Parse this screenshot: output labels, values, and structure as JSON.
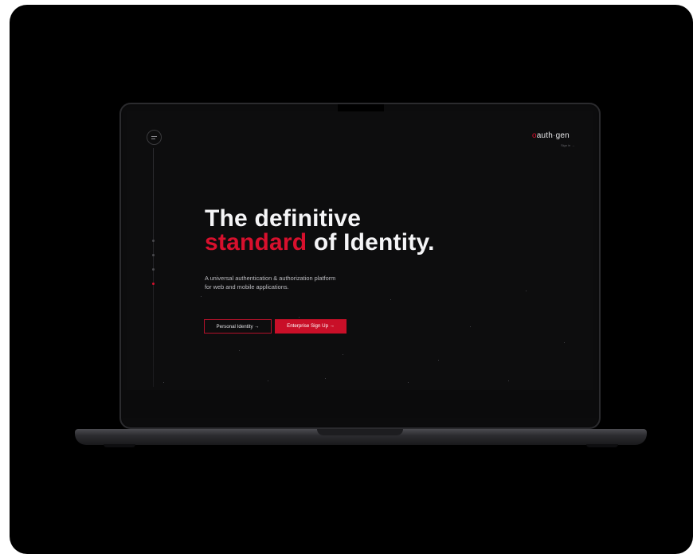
{
  "site": {
    "brand": {
      "prefix": "o",
      "auth": "auth",
      "dot": "·",
      "suffix": "gen"
    },
    "sign_in": "Sign in →",
    "headline": {
      "line1": "The definitive",
      "accent": "standard",
      "rest": " of Identity."
    },
    "subtitle": {
      "line1": "A universal authentication & authorization platform",
      "line2": "for web and mobile applications."
    },
    "buttons": {
      "personal": "Personal Identity →",
      "enterprise": "Enterprise Sign Up →"
    },
    "nav_rail": {
      "dots": 4,
      "active_index": 3
    }
  },
  "colors": {
    "accent": "#d8102d",
    "background": "#0d0d0e",
    "text": "#f5f5f7"
  },
  "icons": {
    "menu": "menu-icon"
  }
}
